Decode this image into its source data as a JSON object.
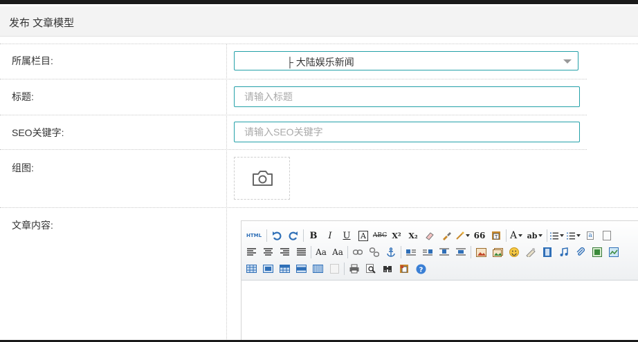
{
  "header": {
    "title": "发布 文章模型"
  },
  "form": {
    "category": {
      "label": "所属栏目:",
      "value": "├ 大陆娱乐新闻"
    },
    "title": {
      "label": "标题:",
      "placeholder": "请输入标题"
    },
    "seo": {
      "label": "SEO关键字:",
      "placeholder": "请输入SEO关键字"
    },
    "gallery": {
      "label": "组图:"
    },
    "content": {
      "label": "文章内容:"
    }
  },
  "toolbar": {
    "html_label": "HTML",
    "bold": "B",
    "italic": "I",
    "underline": "U",
    "superscript": "X²",
    "subscript": "X₂",
    "quote": "66",
    "font_color": "A",
    "highlight": "ab",
    "font_size_inc": "Aa",
    "font_size_dec": "Aa"
  },
  "colors": {
    "accent": "#23a0a8",
    "header_bg": "#f3f3f3",
    "toolbar_blue": "#2f6fb7"
  }
}
